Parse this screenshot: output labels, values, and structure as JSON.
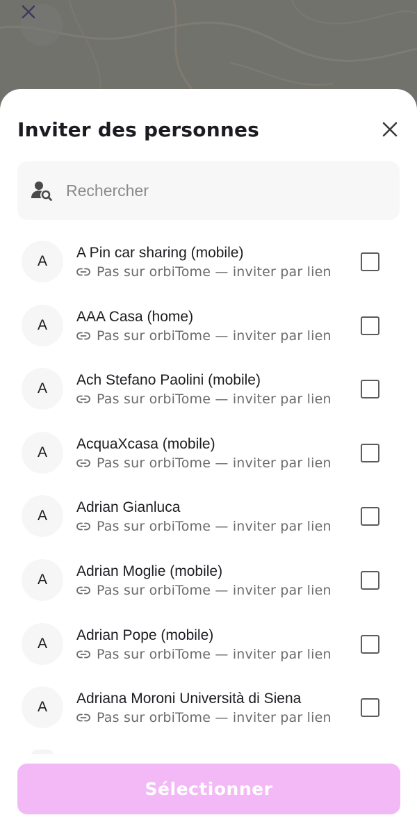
{
  "sheet": {
    "title": "Inviter des personnes"
  },
  "search": {
    "placeholder": "Rechercher"
  },
  "contacts": [
    {
      "initial": "A",
      "name": "A Pin car sharing (mobile)",
      "status": "Pas sur orbiTome — inviter par lien",
      "checked": false
    },
    {
      "initial": "A",
      "name": "AAA Casa (home)",
      "status": "Pas sur orbiTome — inviter par lien",
      "checked": false
    },
    {
      "initial": "A",
      "name": "Ach Stefano Paolini (mobile)",
      "status": "Pas sur orbiTome — inviter par lien",
      "checked": false
    },
    {
      "initial": "A",
      "name": "AcquaXcasa (mobile)",
      "status": "Pas sur orbiTome — inviter par lien",
      "checked": false
    },
    {
      "initial": "A",
      "name": "Adrian Gianluca",
      "status": "Pas sur orbiTome — inviter par lien",
      "checked": false
    },
    {
      "initial": "A",
      "name": "Adrian Moglie (mobile)",
      "status": "Pas sur orbiTome — inviter par lien",
      "checked": false
    },
    {
      "initial": "A",
      "name": "Adrian Pope (mobile)",
      "status": "Pas sur orbiTome — inviter par lien",
      "checked": false
    },
    {
      "initial": "A",
      "name": "Adriana Moroni Università di Siena",
      "status": "Pas sur orbiTome — inviter par lien",
      "checked": false
    }
  ],
  "footer": {
    "select_label": "Sélectionner"
  },
  "icons": {
    "map_close": "close-icon",
    "sheet_close": "close-icon",
    "search": "person-search-icon",
    "row_status": "link-icon"
  },
  "colors": {
    "accent_disabled": "#f2b9f6",
    "title": "#1d1b20",
    "secondary_text": "#6b6b6b",
    "backdrop": "#72726d"
  }
}
